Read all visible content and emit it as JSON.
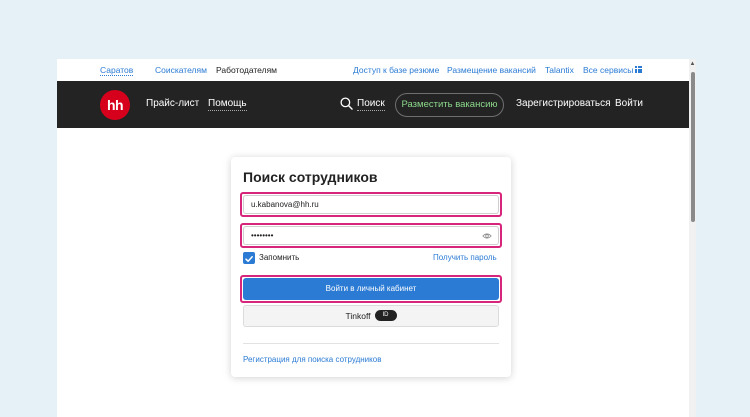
{
  "topbar": {
    "city": "Саратов",
    "seekers": "Соискателям",
    "employers": "Работодателям",
    "resume_access": "Доступ к базе резюме",
    "post_vacancies": "Размещение вакансий",
    "talantix": "Talantix",
    "all_services": "Все сервисы"
  },
  "navbar": {
    "logo": "hh",
    "price_list": "Прайс-лист",
    "help": "Помощь",
    "search": "Поиск",
    "post_vacancy": "Разместить вакансию",
    "register": "Зарегистрироваться",
    "login": "Войти"
  },
  "login_card": {
    "title": "Поиск сотрудников",
    "email_value": "u.kabanova@hh.ru",
    "password_value": "••••••••",
    "remember_label": "Запомнить",
    "forgot_password": "Получить пароль",
    "login_button": "Войти в личный кабинет",
    "tinkoff_button": "Tinkoff",
    "tinkoff_badge": "ID",
    "register_link": "Регистрация для поиска сотрудников"
  },
  "colors": {
    "accent": "#2b7bd4",
    "brand_red": "#d6001c",
    "highlight": "#d6257a",
    "navbar_bg": "#232323",
    "post_button_text": "#8bd88b"
  },
  "icons": [
    "grid-icon",
    "search-icon",
    "eye-icon",
    "check-icon",
    "scroll-up-arrow-icon"
  ]
}
